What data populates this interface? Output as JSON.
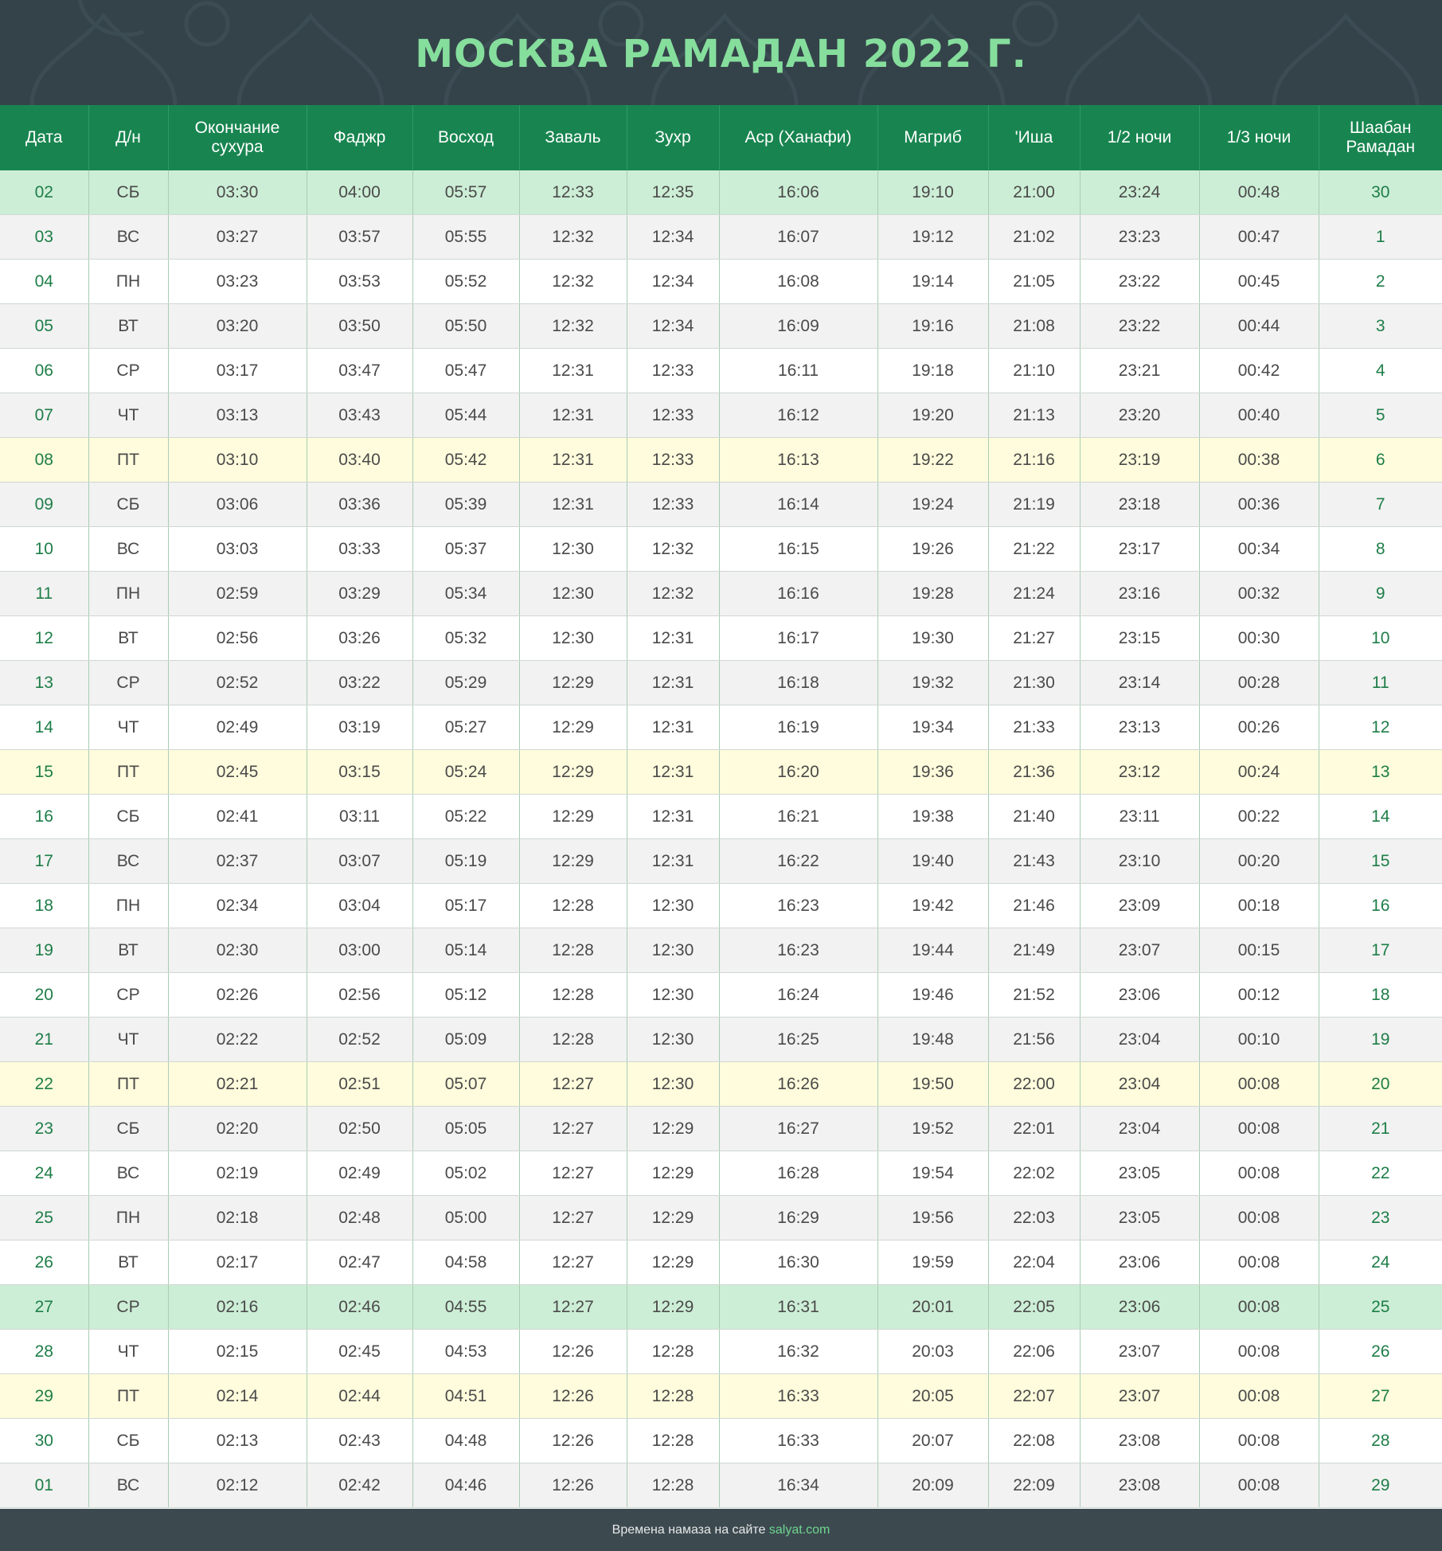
{
  "title": "МОСКВА РАМАДАН 2022 Г.",
  "columns": [
    [
      "Дата"
    ],
    [
      "Д/н"
    ],
    [
      "Окончание",
      "сухура"
    ],
    [
      "Фаджр"
    ],
    [
      "Восход"
    ],
    [
      "Заваль"
    ],
    [
      "Зухр"
    ],
    [
      "Аср (Ханафи)"
    ],
    [
      "Магриб"
    ],
    [
      "'Иша"
    ],
    [
      "1/2 ночи"
    ],
    [
      "1/3 ночи"
    ],
    [
      "Шаабан",
      "Рамадан"
    ]
  ],
  "rows": [
    {
      "style": "highlight",
      "cells": [
        "02",
        "СБ",
        "03:30",
        "04:00",
        "05:57",
        "12:33",
        "12:35",
        "16:06",
        "19:10",
        "21:00",
        "23:24",
        "00:48",
        "30"
      ]
    },
    {
      "style": "even",
      "cells": [
        "03",
        "ВС",
        "03:27",
        "03:57",
        "05:55",
        "12:32",
        "12:34",
        "16:07",
        "19:12",
        "21:02",
        "23:23",
        "00:47",
        "1"
      ]
    },
    {
      "style": "odd",
      "cells": [
        "04",
        "ПН",
        "03:23",
        "03:53",
        "05:52",
        "12:32",
        "12:34",
        "16:08",
        "19:14",
        "21:05",
        "23:22",
        "00:45",
        "2"
      ]
    },
    {
      "style": "even",
      "cells": [
        "05",
        "ВТ",
        "03:20",
        "03:50",
        "05:50",
        "12:32",
        "12:34",
        "16:09",
        "19:16",
        "21:08",
        "23:22",
        "00:44",
        "3"
      ]
    },
    {
      "style": "odd",
      "cells": [
        "06",
        "СР",
        "03:17",
        "03:47",
        "05:47",
        "12:31",
        "12:33",
        "16:11",
        "19:18",
        "21:10",
        "23:21",
        "00:42",
        "4"
      ]
    },
    {
      "style": "even",
      "cells": [
        "07",
        "ЧТ",
        "03:13",
        "03:43",
        "05:44",
        "12:31",
        "12:33",
        "16:12",
        "19:20",
        "21:13",
        "23:20",
        "00:40",
        "5"
      ]
    },
    {
      "style": "friday",
      "cells": [
        "08",
        "ПТ",
        "03:10",
        "03:40",
        "05:42",
        "12:31",
        "12:33",
        "16:13",
        "19:22",
        "21:16",
        "23:19",
        "00:38",
        "6"
      ]
    },
    {
      "style": "even",
      "cells": [
        "09",
        "СБ",
        "03:06",
        "03:36",
        "05:39",
        "12:31",
        "12:33",
        "16:14",
        "19:24",
        "21:19",
        "23:18",
        "00:36",
        "7"
      ]
    },
    {
      "style": "odd",
      "cells": [
        "10",
        "ВС",
        "03:03",
        "03:33",
        "05:37",
        "12:30",
        "12:32",
        "16:15",
        "19:26",
        "21:22",
        "23:17",
        "00:34",
        "8"
      ]
    },
    {
      "style": "even",
      "cells": [
        "11",
        "ПН",
        "02:59",
        "03:29",
        "05:34",
        "12:30",
        "12:32",
        "16:16",
        "19:28",
        "21:24",
        "23:16",
        "00:32",
        "9"
      ]
    },
    {
      "style": "odd",
      "cells": [
        "12",
        "ВТ",
        "02:56",
        "03:26",
        "05:32",
        "12:30",
        "12:31",
        "16:17",
        "19:30",
        "21:27",
        "23:15",
        "00:30",
        "10"
      ]
    },
    {
      "style": "even",
      "cells": [
        "13",
        "СР",
        "02:52",
        "03:22",
        "05:29",
        "12:29",
        "12:31",
        "16:18",
        "19:32",
        "21:30",
        "23:14",
        "00:28",
        "11"
      ]
    },
    {
      "style": "odd",
      "cells": [
        "14",
        "ЧТ",
        "02:49",
        "03:19",
        "05:27",
        "12:29",
        "12:31",
        "16:19",
        "19:34",
        "21:33",
        "23:13",
        "00:26",
        "12"
      ]
    },
    {
      "style": "friday",
      "cells": [
        "15",
        "ПТ",
        "02:45",
        "03:15",
        "05:24",
        "12:29",
        "12:31",
        "16:20",
        "19:36",
        "21:36",
        "23:12",
        "00:24",
        "13"
      ]
    },
    {
      "style": "odd",
      "cells": [
        "16",
        "СБ",
        "02:41",
        "03:11",
        "05:22",
        "12:29",
        "12:31",
        "16:21",
        "19:38",
        "21:40",
        "23:11",
        "00:22",
        "14"
      ]
    },
    {
      "style": "even",
      "cells": [
        "17",
        "ВС",
        "02:37",
        "03:07",
        "05:19",
        "12:29",
        "12:31",
        "16:22",
        "19:40",
        "21:43",
        "23:10",
        "00:20",
        "15"
      ]
    },
    {
      "style": "odd",
      "cells": [
        "18",
        "ПН",
        "02:34",
        "03:04",
        "05:17",
        "12:28",
        "12:30",
        "16:23",
        "19:42",
        "21:46",
        "23:09",
        "00:18",
        "16"
      ]
    },
    {
      "style": "even",
      "cells": [
        "19",
        "ВТ",
        "02:30",
        "03:00",
        "05:14",
        "12:28",
        "12:30",
        "16:23",
        "19:44",
        "21:49",
        "23:07",
        "00:15",
        "17"
      ]
    },
    {
      "style": "odd",
      "cells": [
        "20",
        "СР",
        "02:26",
        "02:56",
        "05:12",
        "12:28",
        "12:30",
        "16:24",
        "19:46",
        "21:52",
        "23:06",
        "00:12",
        "18"
      ]
    },
    {
      "style": "even",
      "cells": [
        "21",
        "ЧТ",
        "02:22",
        "02:52",
        "05:09",
        "12:28",
        "12:30",
        "16:25",
        "19:48",
        "21:56",
        "23:04",
        "00:10",
        "19"
      ]
    },
    {
      "style": "friday",
      "cells": [
        "22",
        "ПТ",
        "02:21",
        "02:51",
        "05:07",
        "12:27",
        "12:30",
        "16:26",
        "19:50",
        "22:00",
        "23:04",
        "00:08",
        "20"
      ]
    },
    {
      "style": "even",
      "cells": [
        "23",
        "СБ",
        "02:20",
        "02:50",
        "05:05",
        "12:27",
        "12:29",
        "16:27",
        "19:52",
        "22:01",
        "23:04",
        "00:08",
        "21"
      ]
    },
    {
      "style": "odd",
      "cells": [
        "24",
        "ВС",
        "02:19",
        "02:49",
        "05:02",
        "12:27",
        "12:29",
        "16:28",
        "19:54",
        "22:02",
        "23:05",
        "00:08",
        "22"
      ]
    },
    {
      "style": "even",
      "cells": [
        "25",
        "ПН",
        "02:18",
        "02:48",
        "05:00",
        "12:27",
        "12:29",
        "16:29",
        "19:56",
        "22:03",
        "23:05",
        "00:08",
        "23"
      ]
    },
    {
      "style": "odd",
      "cells": [
        "26",
        "ВТ",
        "02:17",
        "02:47",
        "04:58",
        "12:27",
        "12:29",
        "16:30",
        "19:59",
        "22:04",
        "23:06",
        "00:08",
        "24"
      ]
    },
    {
      "style": "highlight",
      "cells": [
        "27",
        "СР",
        "02:16",
        "02:46",
        "04:55",
        "12:27",
        "12:29",
        "16:31",
        "20:01",
        "22:05",
        "23:06",
        "00:08",
        "25"
      ]
    },
    {
      "style": "odd",
      "cells": [
        "28",
        "ЧТ",
        "02:15",
        "02:45",
        "04:53",
        "12:26",
        "12:28",
        "16:32",
        "20:03",
        "22:06",
        "23:07",
        "00:08",
        "26"
      ]
    },
    {
      "style": "friday",
      "cells": [
        "29",
        "ПТ",
        "02:14",
        "02:44",
        "04:51",
        "12:26",
        "12:28",
        "16:33",
        "20:05",
        "22:07",
        "23:07",
        "00:08",
        "27"
      ]
    },
    {
      "style": "odd",
      "cells": [
        "30",
        "СБ",
        "02:13",
        "02:43",
        "04:48",
        "12:26",
        "12:28",
        "16:33",
        "20:07",
        "22:08",
        "23:08",
        "00:08",
        "28"
      ]
    },
    {
      "style": "even",
      "cells": [
        "01",
        "ВС",
        "02:12",
        "02:42",
        "04:46",
        "12:26",
        "12:28",
        "16:34",
        "20:09",
        "22:09",
        "23:08",
        "00:08",
        "29"
      ]
    }
  ],
  "footer": {
    "text": "Времена намаза на сайте ",
    "site": "salyat.com"
  },
  "colors": {
    "banner": "#34434a",
    "title": "#86de9d",
    "header": "#188550",
    "friday_row": "#fefcdc",
    "highlight_row": "#cdeed6",
    "footer": "#3c4a50",
    "link": "#6fd68f"
  }
}
